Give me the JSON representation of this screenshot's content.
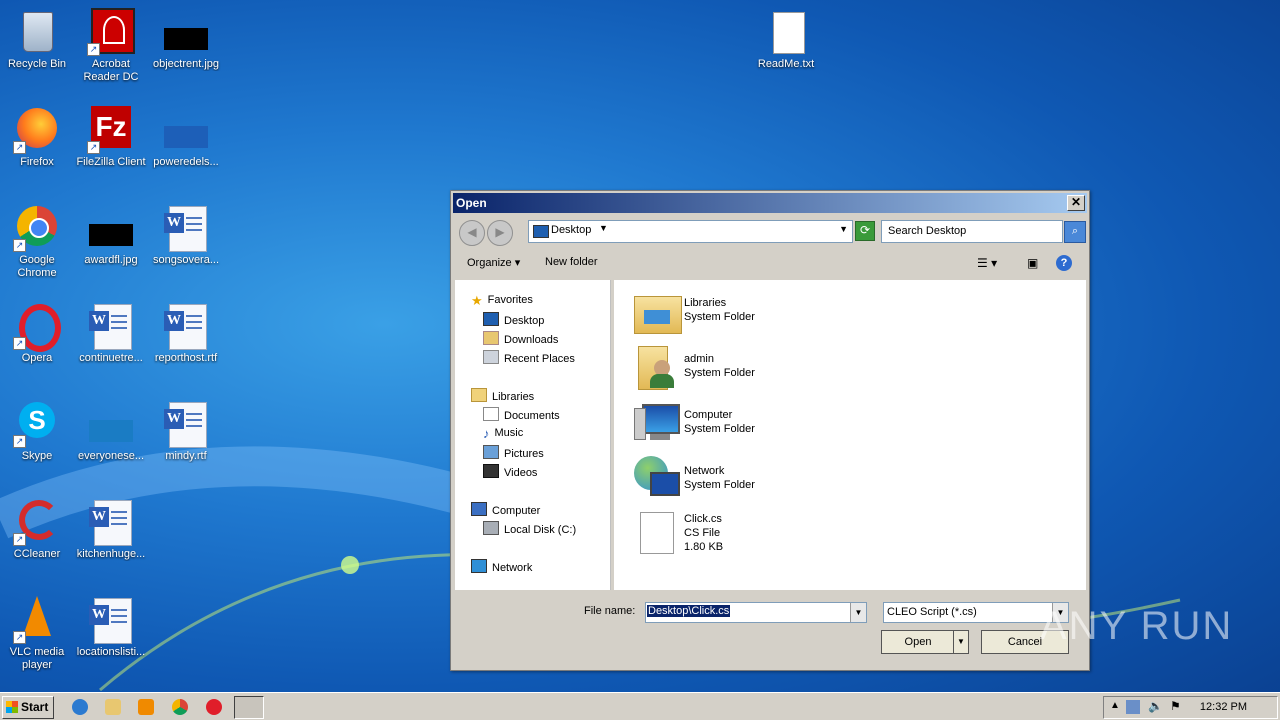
{
  "desktop": {
    "icons": [
      {
        "label": "Recycle Bin",
        "icon": "recycle-bin-icon"
      },
      {
        "label": "Acrobat Reader DC",
        "icon": "acrobat-icon"
      },
      {
        "label": "objectrent.jpg",
        "icon": "image-icon"
      },
      {
        "label": "ReadMe.txt",
        "icon": "text-file-icon"
      },
      {
        "label": "Firefox",
        "icon": "firefox-icon"
      },
      {
        "label": "FileZilla Client",
        "icon": "filezilla-icon"
      },
      {
        "label": "poweredels...",
        "icon": "image-icon"
      },
      {
        "label": "Google Chrome",
        "icon": "chrome-icon"
      },
      {
        "label": "awardfl.jpg",
        "icon": "image-icon"
      },
      {
        "label": "songsovera...",
        "icon": "word-doc-icon"
      },
      {
        "label": "Opera",
        "icon": "opera-icon"
      },
      {
        "label": "continuetre...",
        "icon": "word-doc-icon"
      },
      {
        "label": "reporthost.rtf",
        "icon": "word-doc-icon"
      },
      {
        "label": "Skype",
        "icon": "skype-icon"
      },
      {
        "label": "everyonese...",
        "icon": "image-icon"
      },
      {
        "label": "mindy.rtf",
        "icon": "word-doc-icon"
      },
      {
        "label": "CCleaner",
        "icon": "ccleaner-icon"
      },
      {
        "label": "kitchenhuge...",
        "icon": "word-doc-icon"
      },
      {
        "label": "VLC media player",
        "icon": "vlc-icon"
      },
      {
        "label": "locationslisti...",
        "icon": "word-doc-icon"
      }
    ]
  },
  "dialog": {
    "title": "Open",
    "close": "✕",
    "address": "Desktop",
    "search_placeholder": "Search Desktop",
    "toolbar": {
      "organize": "Organize",
      "new_folder": "New folder"
    },
    "nav": {
      "favorites": "Favorites",
      "desktop": "Desktop",
      "downloads": "Downloads",
      "recent": "Recent Places",
      "libraries": "Libraries",
      "documents": "Documents",
      "music": "Music",
      "pictures": "Pictures",
      "videos": "Videos",
      "computer": "Computer",
      "local_disk": "Local Disk (C:)",
      "network": "Network"
    },
    "files": [
      {
        "name": "Libraries",
        "type": "System Folder",
        "size": ""
      },
      {
        "name": "admin",
        "type": "System Folder",
        "size": ""
      },
      {
        "name": "Computer",
        "type": "System Folder",
        "size": ""
      },
      {
        "name": "Network",
        "type": "System Folder",
        "size": ""
      },
      {
        "name": "Click.cs",
        "type": "CS File",
        "size": "1.80 KB"
      }
    ],
    "file_name_label": "File name:",
    "file_name_value": "Desktop\\Click.cs",
    "file_type_value": "CLEO Script (*.cs)",
    "open_label": "Open",
    "cancel_label": "Cancel"
  },
  "taskbar": {
    "start_label": "Start",
    "clock": "12:32 PM"
  },
  "watermark": "ANY RUN"
}
